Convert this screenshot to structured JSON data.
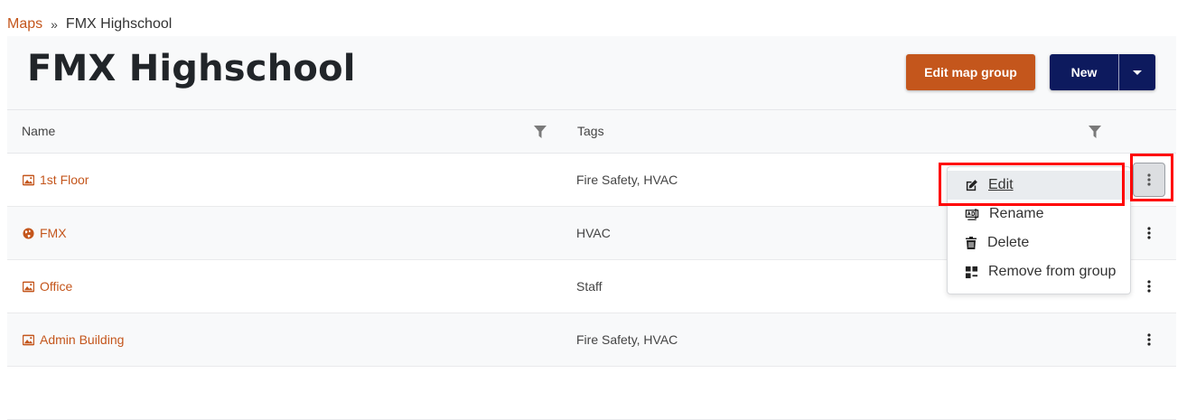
{
  "breadcrumb": {
    "link": "Maps",
    "separator": "»",
    "current": "FMX Highschool"
  },
  "page": {
    "title": "FMX Highschool"
  },
  "toolbar": {
    "edit_group_label": "Edit map group",
    "new_label": "New"
  },
  "table": {
    "columns": {
      "name": "Name",
      "tags": "Tags"
    },
    "rows": [
      {
        "name": "1st Floor",
        "icon": "image-icon",
        "tags": "Fire Safety, HVAC"
      },
      {
        "name": "FMX",
        "icon": "globe-icon",
        "tags": "HVAC"
      },
      {
        "name": "Office",
        "icon": "image-icon",
        "tags": "Staff"
      },
      {
        "name": "Admin Building",
        "icon": "image-icon",
        "tags": "Fire Safety, HVAC"
      }
    ]
  },
  "menu": {
    "items": [
      {
        "label": "Edit",
        "icon": "edit-icon"
      },
      {
        "label": "Rename",
        "icon": "rename-icon"
      },
      {
        "label": "Delete",
        "icon": "trash-icon"
      },
      {
        "label": "Remove from group",
        "icon": "remove-from-group-icon"
      }
    ]
  },
  "colors": {
    "accent": "#c4561c",
    "primary": "#0d1a5e",
    "highlight": "#ff0000"
  }
}
